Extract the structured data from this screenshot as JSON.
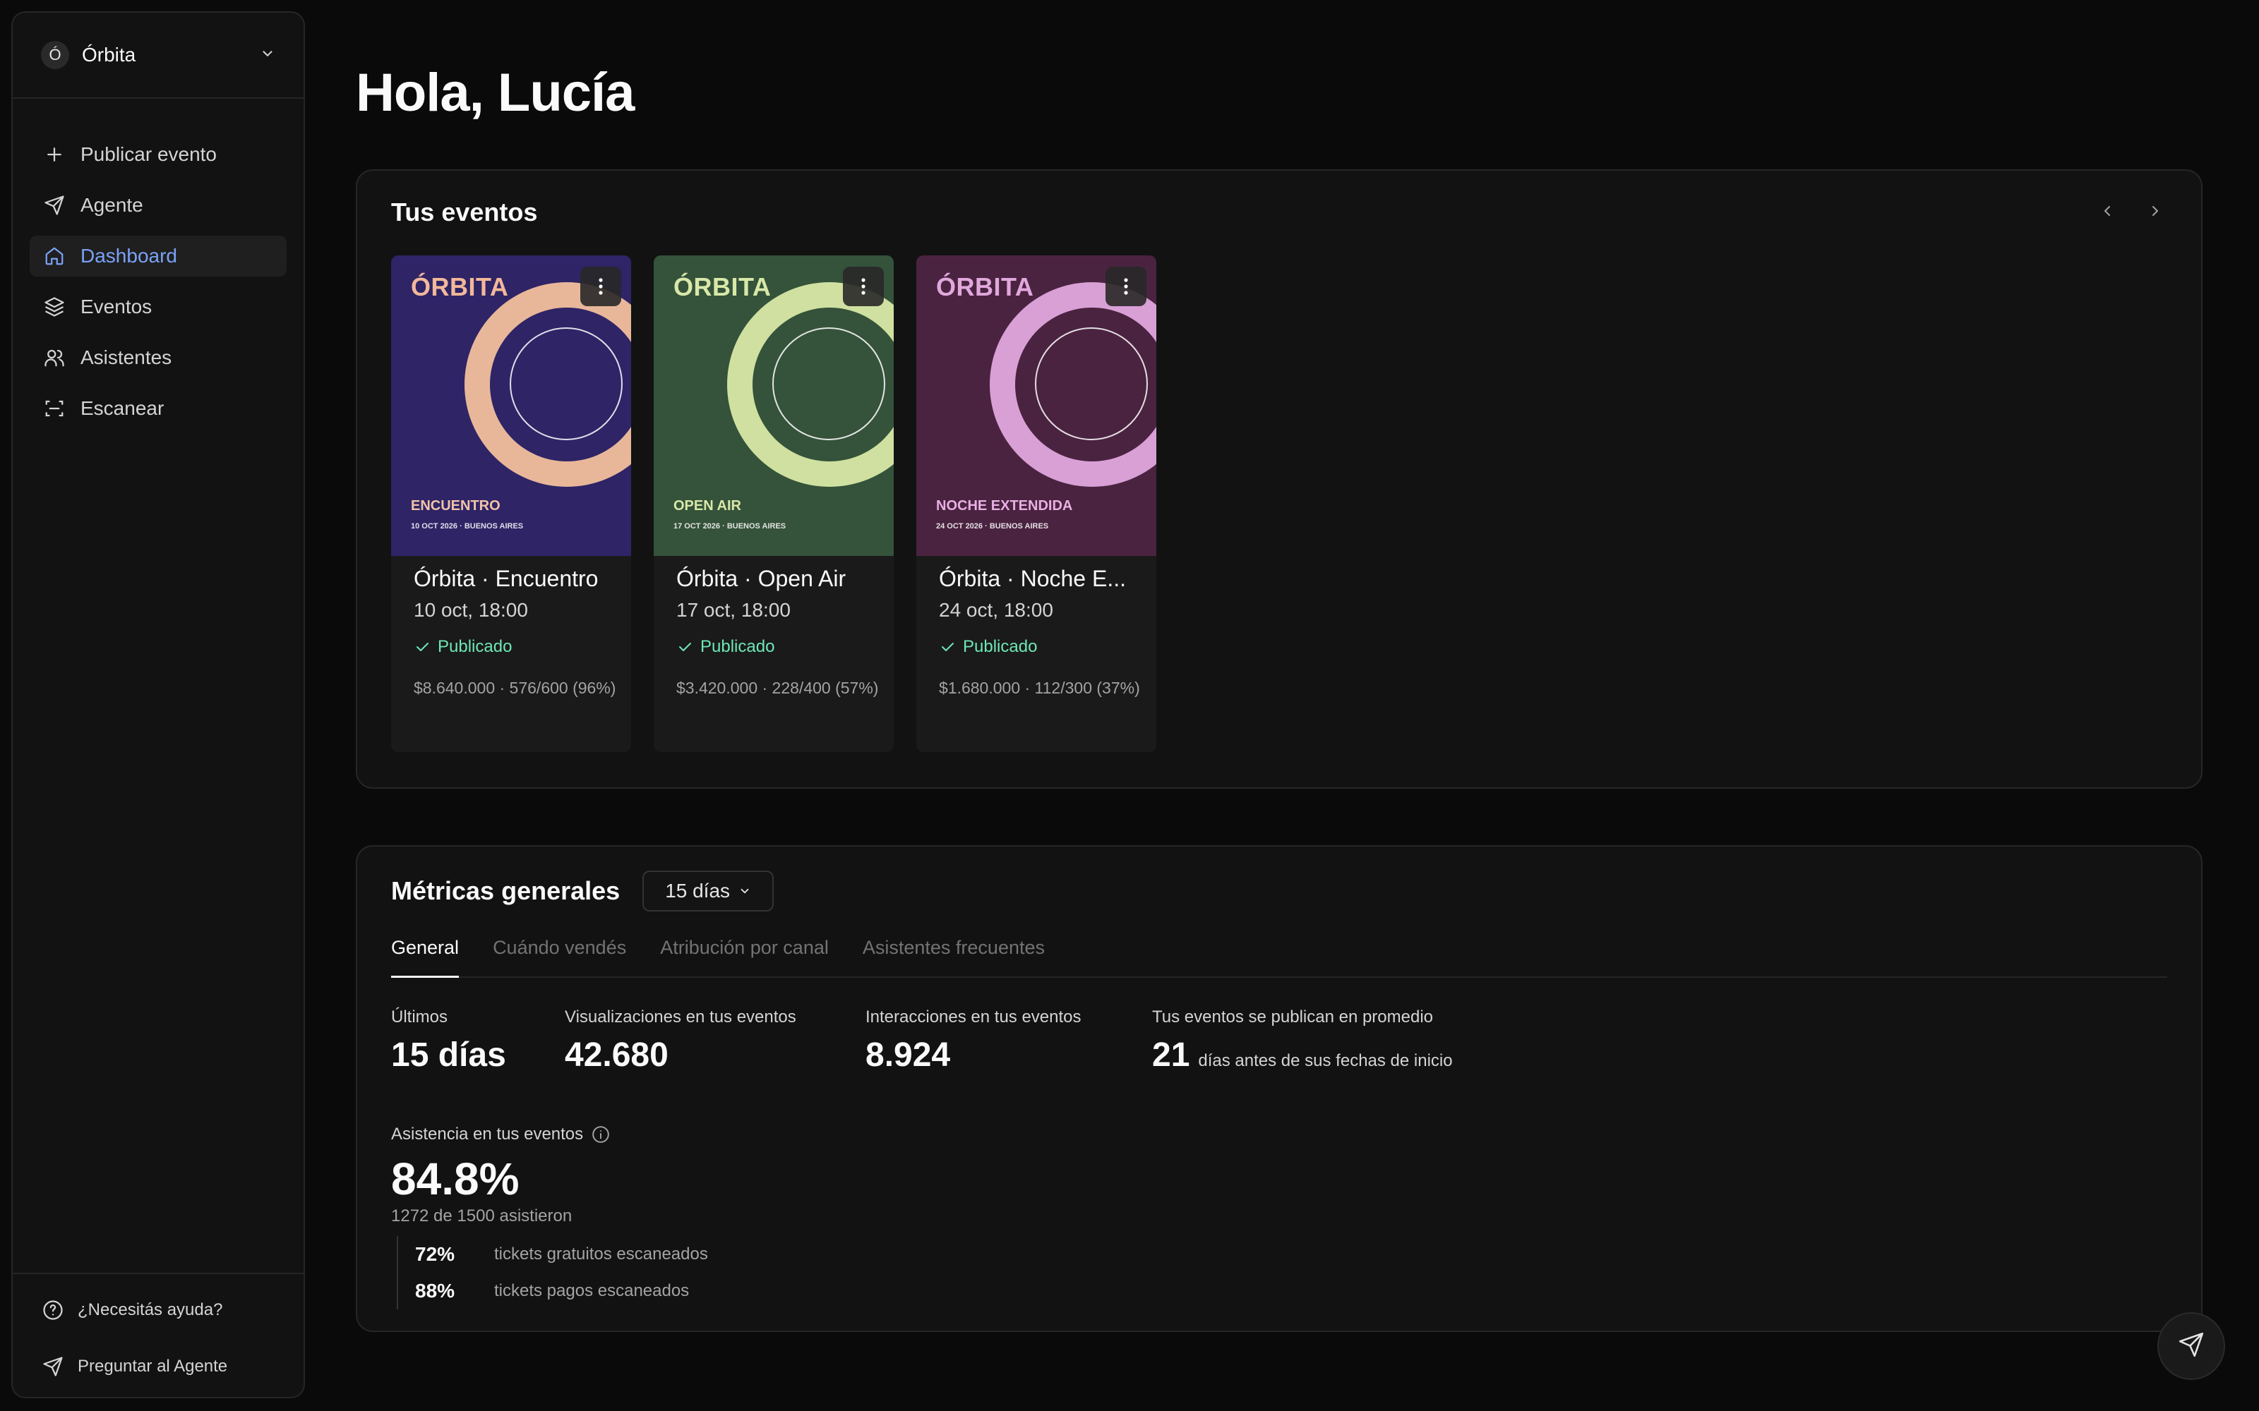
{
  "org": {
    "initial": "Ó",
    "name": "Órbita"
  },
  "nav": {
    "publish": "Publicar evento",
    "agent": "Agente",
    "dashboard": "Dashboard",
    "events": "Eventos",
    "attendees": "Asistentes",
    "scan": "Escanear"
  },
  "footer": {
    "help": "¿Necesitás ayuda?",
    "ask_agent": "Preguntar al Agente"
  },
  "greeting": "Hola, Lucía",
  "events_section": {
    "title": "Tus eventos",
    "cards": [
      {
        "poster_brand": "ÓRBITA",
        "poster_sub": "ENCUENTRO",
        "poster_date": "10 OCT 2026 · BUENOS AIRES",
        "title": "Órbita · Encuentro",
        "date": "10 oct, 18:00",
        "status": "Publicado",
        "stats": "$8.640.000 · 576/600 (96%)",
        "colors": {
          "bg": "#2e2466",
          "accent": "#e8b79a",
          "brand": "#f2b89a",
          "sub": "#f2c4a8"
        }
      },
      {
        "poster_brand": "ÓRBITA",
        "poster_sub": "OPEN AIR",
        "poster_date": "17 OCT 2026 · BUENOS AIRES",
        "title": "Órbita · Open Air",
        "date": "17 oct, 18:00",
        "status": "Publicado",
        "stats": "$3.420.000 · 228/400 (57%)",
        "colors": {
          "bg": "#35523a",
          "accent": "#cfe0a0",
          "brand": "#d8e8a8",
          "sub": "#d8e8a8"
        }
      },
      {
        "poster_brand": "ÓRBITA",
        "poster_sub": "NOCHE EXTENDIDA",
        "poster_date": "24 OCT 2026 · BUENOS AIRES",
        "title": "Órbita · Noche E...",
        "date": "24 oct, 18:00",
        "status": "Publicado",
        "stats": "$1.680.000 · 112/300 (37%)",
        "colors": {
          "bg": "#4a2340",
          "accent": "#d9a0d6",
          "brand": "#e0a8dc",
          "sub": "#e8b0e2"
        }
      }
    ]
  },
  "metrics": {
    "title": "Métricas generales",
    "period": "15 días",
    "tabs": [
      "General",
      "Cuándo vendés",
      "Atribución por canal",
      "Asistentes frecuentes"
    ],
    "stats": {
      "last_label": "Últimos",
      "last_value": "15 días",
      "views_label": "Visualizaciones en tus eventos",
      "views_value": "42.680",
      "interactions_label": "Interacciones en tus eventos",
      "interactions_value": "8.924",
      "publish_label": "Tus eventos se publican en promedio",
      "publish_value": "21",
      "publish_suffix": "días antes de sus fechas de inicio"
    },
    "attendance": {
      "label": "Asistencia en tus eventos",
      "value": "84.8%",
      "sub": "1272 de 1500 asistieron",
      "rows": [
        {
          "pct": "72%",
          "desc": "tickets gratuitos escaneados"
        },
        {
          "pct": "88%",
          "desc": "tickets pagos escaneados"
        }
      ]
    }
  }
}
